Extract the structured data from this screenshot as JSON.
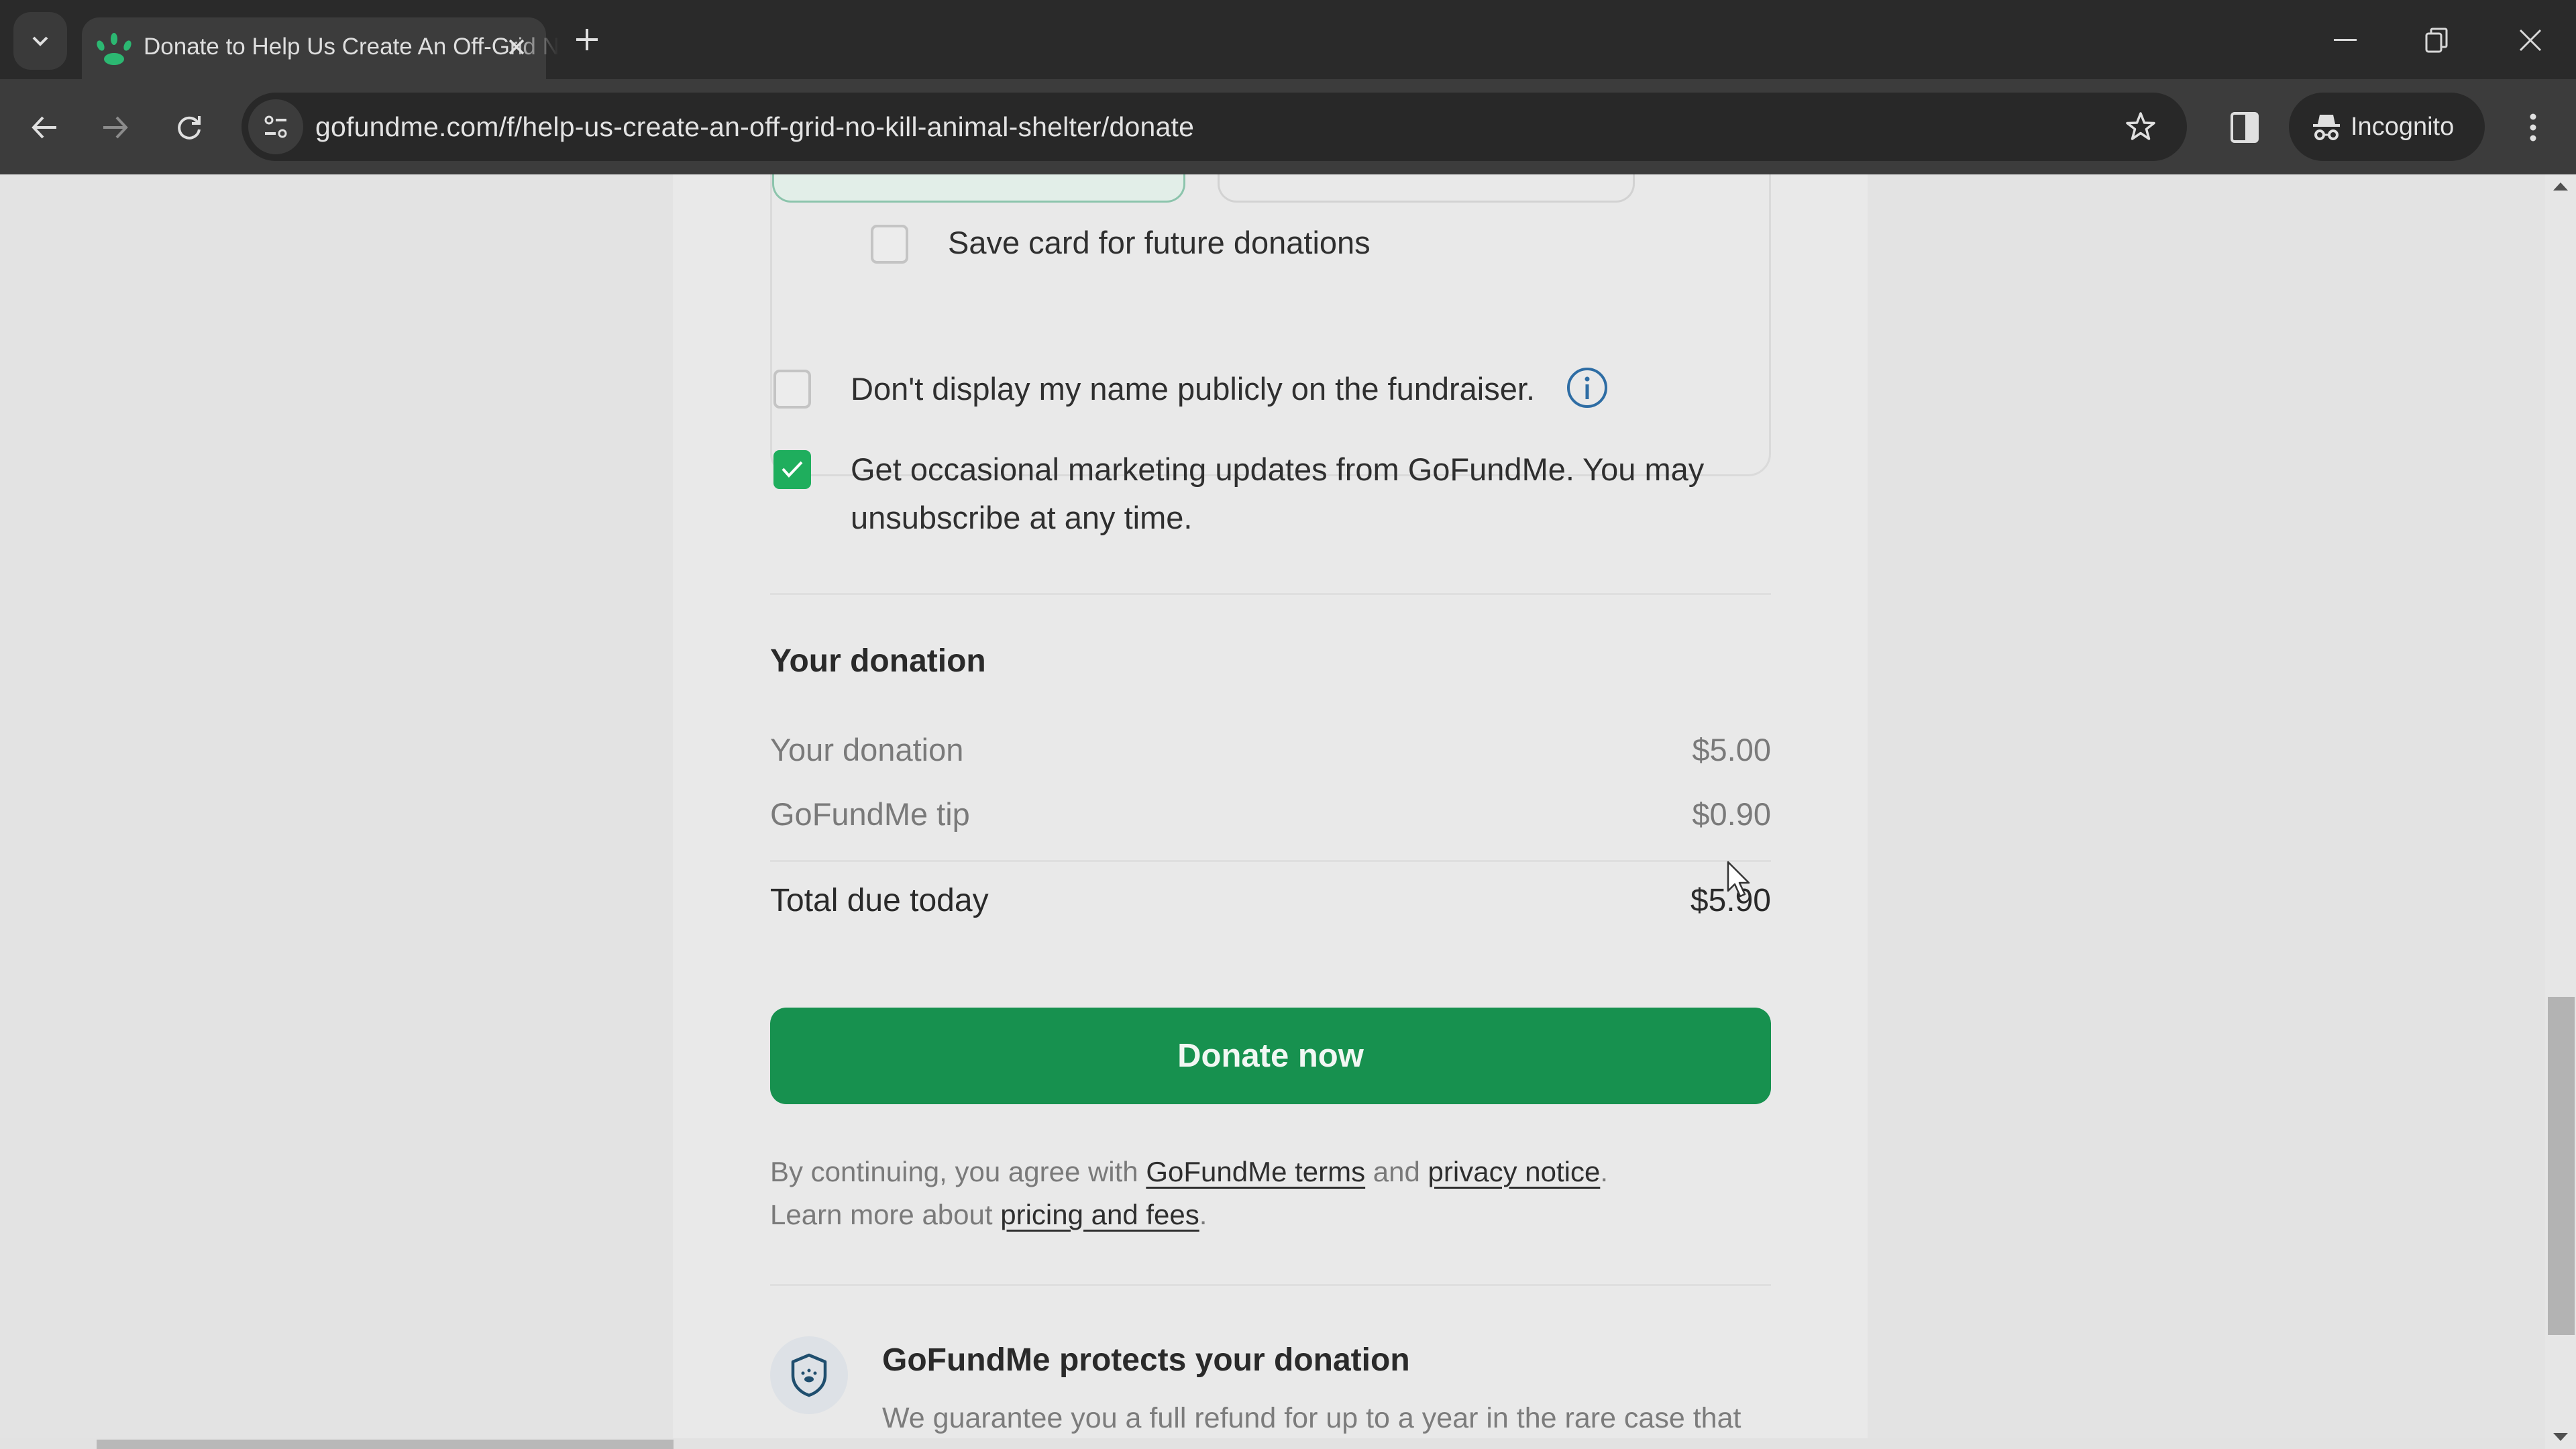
{
  "browser": {
    "tab": {
      "title": "Donate to Help Us Create An Off-Grid No-Kill Animal Shelter",
      "favicon": "gofundme-paw-icon",
      "close_label": "×"
    },
    "new_tab_label": "+",
    "url": "gofundme.com/f/help-us-create-an-off-grid-no-kill-animal-shelter/donate",
    "incognito_label": "Incognito",
    "icons": {
      "tab_search": "chevron-down-icon",
      "back": "arrow-left-icon",
      "forward": "arrow-right-icon",
      "reload": "reload-icon",
      "site_info": "tune-icon",
      "bookmark": "star-icon",
      "side_panel": "side-panel-icon",
      "incognito": "incognito-icon",
      "menu": "kebab-menu-icon",
      "minimize": "minimize-icon",
      "restore": "restore-icon",
      "close": "close-icon"
    }
  },
  "page": {
    "save_card": {
      "label": "Save card for future donations",
      "checked": false
    },
    "anonymous": {
      "label": "Don't display my name publicly on the fundraiser.",
      "checked": false,
      "info_icon": "info-icon"
    },
    "marketing": {
      "label_line1": "Get occasional marketing updates from GoFundMe. You may",
      "label_line2": "unsubscribe at any time.",
      "checked": true
    },
    "summary": {
      "title": "Your donation",
      "rows": [
        {
          "label": "Your donation",
          "value": "$5.00"
        },
        {
          "label": "GoFundMe tip",
          "value": "$0.90"
        }
      ],
      "total_label": "Total due today",
      "total_value": "$5.90"
    },
    "donate_button": "Donate now",
    "legal": {
      "prefix": "By continuing, you agree with ",
      "terms_link": "GoFundMe terms",
      "and": " and ",
      "privacy_link": "privacy notice",
      "period": ".",
      "learn_prefix": "Learn more about ",
      "pricing_link": "pricing and fees",
      "period2": "."
    },
    "protect": {
      "icon": "shield-paw-icon",
      "title": "GoFundMe protects your donation",
      "body": "We guarantee you a full refund for up to a year in the rare case that"
    }
  },
  "colors": {
    "brand_green": "#17914f",
    "checkbox_green": "#1fae5d",
    "info_blue": "#2e6da4",
    "shield_blue": "#1f4e6e"
  },
  "scroll": {
    "vertical_position_fraction": 0.75
  }
}
